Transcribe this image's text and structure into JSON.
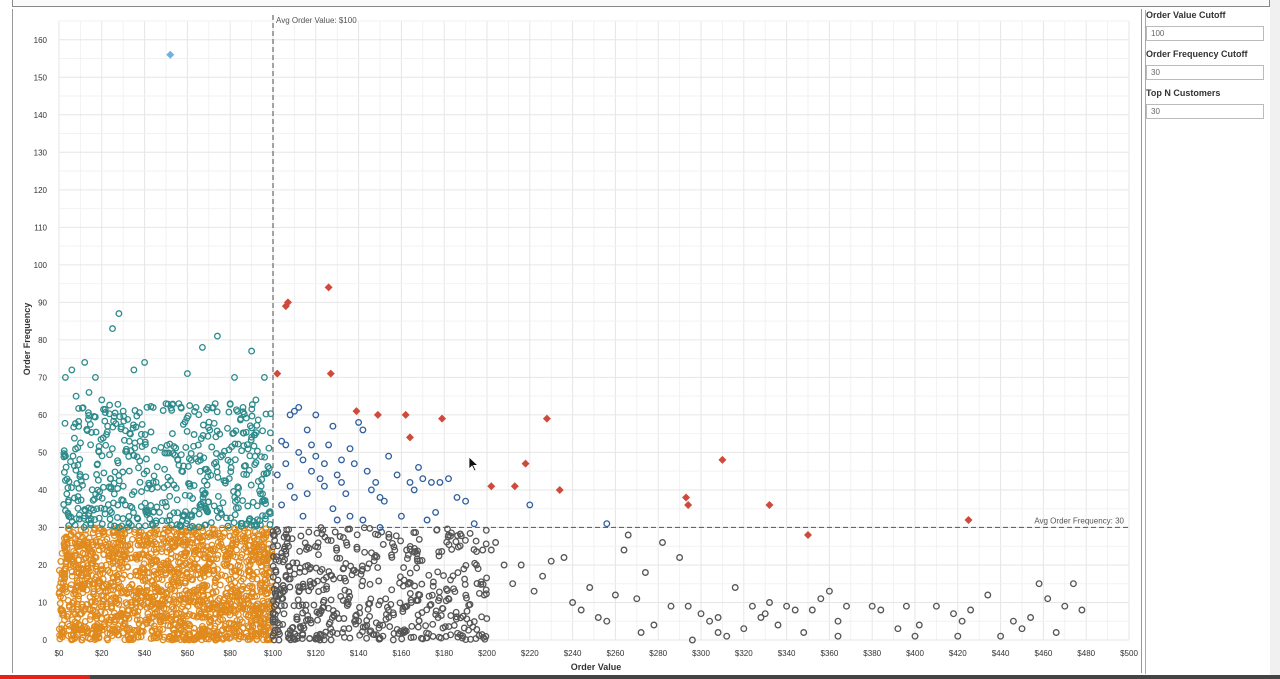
{
  "parameters": [
    {
      "label": "Order Value Cutoff",
      "value": "100"
    },
    {
      "label": "Order Frequency Cutoff",
      "value": "30"
    },
    {
      "label": "Top N Customers",
      "value": "30"
    }
  ],
  "video_progress": 0.07,
  "chart_data": {
    "type": "scatter",
    "xlabel": "Order Value",
    "ylabel": "Order Frequency",
    "xlim": [
      0,
      500
    ],
    "ylim": [
      0,
      165
    ],
    "x_ticks": [
      0,
      20,
      40,
      60,
      80,
      100,
      120,
      140,
      160,
      180,
      200,
      220,
      240,
      260,
      280,
      300,
      320,
      340,
      360,
      380,
      400,
      420,
      440,
      460,
      480,
      500
    ],
    "x_tick_labels": [
      "$0",
      "$20",
      "$40",
      "$60",
      "$80",
      "$100",
      "$120",
      "$140",
      "$160",
      "$180",
      "$200",
      "$220",
      "$240",
      "$260",
      "$280",
      "$300",
      "$320",
      "$340",
      "$360",
      "$380",
      "$400",
      "$420",
      "$440",
      "$460",
      "$480",
      "$500"
    ],
    "y_ticks": [
      0,
      10,
      20,
      30,
      40,
      50,
      60,
      70,
      80,
      90,
      100,
      110,
      120,
      130,
      140,
      150,
      160
    ],
    "y_tick_labels": [
      "0",
      "10",
      "20",
      "30",
      "40",
      "50",
      "60",
      "70",
      "80",
      "90",
      "100",
      "110",
      "120",
      "130",
      "140",
      "150",
      "160"
    ],
    "grid": true,
    "reference_lines": [
      {
        "axis": "x",
        "value": 100,
        "label": "Avg Order Value: $100"
      },
      {
        "axis": "y",
        "value": 30,
        "label": "Avg Order Frequency: 30"
      }
    ],
    "colors": {
      "low_value_low_freq": "#e08a1e",
      "low_value_high_freq": "#2e8b8b",
      "high_value_high_freq": "#2f5f9e",
      "high_value_low_freq": "#555555",
      "top_customers": "#d04a3c",
      "outlier": "#6fb1e0"
    },
    "series": [
      {
        "key": "top_customers",
        "marker": "diamond",
        "points": [
          [
            106,
            89
          ],
          [
            107,
            90
          ],
          [
            126,
            94
          ],
          [
            102,
            71
          ],
          [
            127,
            71
          ],
          [
            139,
            61
          ],
          [
            149,
            60
          ],
          [
            162,
            60
          ],
          [
            164,
            54
          ],
          [
            179,
            59
          ],
          [
            202,
            41
          ],
          [
            213,
            41
          ],
          [
            218,
            47
          ],
          [
            228,
            59
          ],
          [
            234,
            40
          ],
          [
            293,
            38
          ],
          [
            294,
            36
          ],
          [
            310,
            48
          ],
          [
            332,
            36
          ],
          [
            350,
            28
          ],
          [
            425,
            32
          ]
        ]
      },
      {
        "key": "outlier",
        "marker": "diamond",
        "points": [
          [
            52,
            156
          ]
        ]
      },
      {
        "key": "high_value_high_freq",
        "marker": "circle",
        "points": [
          [
            102,
            44
          ],
          [
            104,
            53
          ],
          [
            106,
            52
          ],
          [
            108,
            60
          ],
          [
            110,
            61
          ],
          [
            112,
            62
          ],
          [
            114,
            48
          ],
          [
            116,
            39
          ],
          [
            118,
            45
          ],
          [
            120,
            60
          ],
          [
            122,
            43
          ],
          [
            124,
            41
          ],
          [
            126,
            52
          ],
          [
            128,
            57
          ],
          [
            130,
            44
          ],
          [
            132,
            42
          ],
          [
            134,
            39
          ],
          [
            136,
            51
          ],
          [
            138,
            47
          ],
          [
            140,
            58
          ],
          [
            142,
            56
          ],
          [
            144,
            45
          ],
          [
            146,
            40
          ],
          [
            148,
            42
          ],
          [
            150,
            38
          ],
          [
            152,
            37
          ],
          [
            154,
            49
          ],
          [
            158,
            44
          ],
          [
            160,
            33
          ],
          [
            164,
            42
          ],
          [
            166,
            40
          ],
          [
            170,
            43
          ],
          [
            174,
            42
          ],
          [
            176,
            34
          ],
          [
            178,
            42
          ],
          [
            182,
            43
          ],
          [
            186,
            38
          ],
          [
            190,
            37
          ],
          [
            194,
            31
          ],
          [
            220,
            36
          ],
          [
            256,
            31
          ],
          [
            112,
            50
          ],
          [
            104,
            36
          ],
          [
            108,
            41
          ],
          [
            114,
            33
          ],
          [
            118,
            52
          ],
          [
            124,
            47
          ],
          [
            130,
            32
          ],
          [
            136,
            33
          ],
          [
            142,
            32
          ],
          [
            150,
            30
          ],
          [
            168,
            46
          ],
          [
            172,
            32
          ],
          [
            106,
            47
          ],
          [
            110,
            38
          ],
          [
            116,
            56
          ],
          [
            120,
            49
          ],
          [
            128,
            35
          ],
          [
            132,
            48
          ]
        ]
      },
      {
        "key": "high_value_low_freq",
        "marker": "circle",
        "points": [
          [
            198,
            24
          ],
          [
            202,
            24
          ],
          [
            204,
            26
          ],
          [
            208,
            20
          ],
          [
            212,
            15
          ],
          [
            216,
            20
          ],
          [
            222,
            13
          ],
          [
            226,
            17
          ],
          [
            230,
            21
          ],
          [
            236,
            22
          ],
          [
            240,
            10
          ],
          [
            244,
            8
          ],
          [
            248,
            14
          ],
          [
            252,
            6
          ],
          [
            256,
            5
          ],
          [
            260,
            12
          ],
          [
            264,
            24
          ],
          [
            266,
            28
          ],
          [
            270,
            11
          ],
          [
            274,
            18
          ],
          [
            278,
            4
          ],
          [
            282,
            26
          ],
          [
            286,
            9
          ],
          [
            290,
            22
          ],
          [
            294,
            9
          ],
          [
            300,
            7
          ],
          [
            304,
            5
          ],
          [
            308,
            2
          ],
          [
            312,
            1
          ],
          [
            316,
            14
          ],
          [
            320,
            3
          ],
          [
            324,
            9
          ],
          [
            328,
            6
          ],
          [
            332,
            10
          ],
          [
            336,
            4
          ],
          [
            340,
            9
          ],
          [
            344,
            8
          ],
          [
            348,
            2
          ],
          [
            352,
            8
          ],
          [
            356,
            11
          ],
          [
            360,
            13
          ],
          [
            364,
            5
          ],
          [
            368,
            9
          ],
          [
            380,
            9
          ],
          [
            384,
            8
          ],
          [
            392,
            3
          ],
          [
            396,
            9
          ],
          [
            402,
            4
          ],
          [
            410,
            9
          ],
          [
            418,
            7
          ],
          [
            422,
            5
          ],
          [
            426,
            8
          ],
          [
            434,
            12
          ],
          [
            440,
            1
          ],
          [
            446,
            5
          ],
          [
            450,
            3
          ],
          [
            454,
            6
          ],
          [
            458,
            15
          ],
          [
            462,
            11
          ],
          [
            466,
            2
          ],
          [
            470,
            9
          ],
          [
            474,
            15
          ],
          [
            478,
            8
          ],
          [
            400,
            1
          ],
          [
            420,
            1
          ],
          [
            364,
            1
          ],
          [
            330,
            7
          ],
          [
            296,
            0
          ],
          [
            308,
            6
          ],
          [
            272,
            2
          ]
        ]
      }
    ],
    "clusters": [
      {
        "key": "low_value_low_freq",
        "x_range": [
          0,
          100
        ],
        "y_range": [
          0,
          30
        ],
        "count": 1600
      },
      {
        "key": "low_value_high_freq",
        "x_range": [
          2,
          99
        ],
        "y_range": [
          30,
          63
        ],
        "count": 520
      },
      {
        "key": "high_value_low_freq",
        "x_range": [
          100,
          200
        ],
        "y_range": [
          0,
          30
        ],
        "count": 520
      }
    ],
    "sparse_points": {
      "low_value_high_freq": [
        [
          3,
          70
        ],
        [
          6,
          72
        ],
        [
          12,
          74
        ],
        [
          17,
          70
        ],
        [
          25,
          83
        ],
        [
          28,
          87
        ],
        [
          35,
          72
        ],
        [
          40,
          74
        ],
        [
          60,
          71
        ],
        [
          67,
          78
        ],
        [
          74,
          81
        ],
        [
          82,
          70
        ],
        [
          90,
          77
        ],
        [
          96,
          70
        ],
        [
          8,
          65
        ],
        [
          14,
          66
        ],
        [
          20,
          64
        ],
        [
          30,
          61
        ],
        [
          44,
          62
        ],
        [
          50,
          63
        ],
        [
          56,
          63
        ],
        [
          64,
          62
        ],
        [
          72,
          62
        ],
        [
          80,
          63
        ],
        [
          86,
          62
        ],
        [
          92,
          64
        ]
      ]
    }
  }
}
